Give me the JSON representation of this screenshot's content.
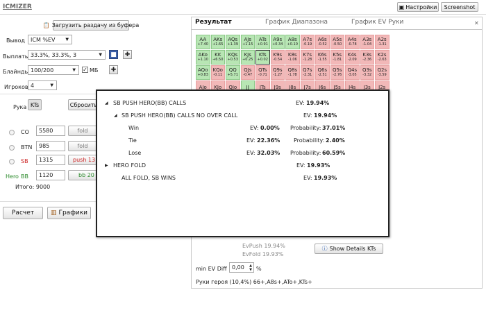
{
  "app": {
    "title": "ICMIZER"
  },
  "header": {
    "settings": "Настройки",
    "screenshot": "Screenshot"
  },
  "left": {
    "load_button": "Загрузить раздачу из буфера",
    "output_label": "Вывод",
    "output_value": "ICM %EV",
    "payouts_label": "Выплаты",
    "payouts_value": "33.3%, 33.3%, 3",
    "blinds_label": "Блайнды",
    "blinds_value": "100/200",
    "mb_label": "МБ",
    "players_label": "Игроков",
    "players_value": "4",
    "hand_label": "Рука",
    "hand_value": "KTs",
    "reset_button": "Сбросить",
    "players": [
      {
        "pos": "CO",
        "stack": "5580",
        "action": "fold"
      },
      {
        "pos": "BTN",
        "stack": "985",
        "action": "fold"
      },
      {
        "pos": "SB",
        "stack": "1315",
        "action": "push 13"
      },
      {
        "pos": "BB",
        "prefix": "Hero",
        "stack": "1120",
        "action": "bb 20"
      }
    ],
    "total": "Итого:  9000",
    "calc_button": "Расчет",
    "charts_button": "Графики"
  },
  "tabs": [
    "Результат",
    "График Диапазона",
    "График EV Руки"
  ],
  "grid": {
    "rows": [
      [
        [
          "AA",
          "+7.40"
        ],
        [
          "AKs",
          "+1.65"
        ],
        [
          "AQs",
          "+1.39"
        ],
        [
          "AJs",
          "+1.15"
        ],
        [
          "ATs",
          "+0.91"
        ],
        [
          "A9s",
          "+0.34"
        ],
        [
          "A8s",
          "+0.10"
        ],
        [
          "A7s",
          "-0.19"
        ],
        [
          "A6s",
          "-0.52"
        ],
        [
          "A5s",
          "-0.50"
        ],
        [
          "A4s",
          "-0.78"
        ],
        [
          "A3s",
          "-1.04"
        ],
        [
          "A2s",
          "-1.31"
        ]
      ],
      [
        [
          "AKo",
          "+1.10"
        ],
        [
          "KK",
          "+6.50"
        ],
        [
          "KQs",
          "+0.53"
        ],
        [
          "KJs",
          "+0.25"
        ],
        [
          "KTs",
          "+0.02"
        ],
        [
          "K9s",
          "-0.54"
        ],
        [
          "K8s",
          "-1.06"
        ],
        [
          "K7s",
          "-1.28"
        ],
        [
          "K6s",
          "-1.55"
        ],
        [
          "K5s",
          "-1.81"
        ],
        [
          "K4s",
          "-2.09"
        ],
        [
          "K3s",
          "-2.36"
        ],
        [
          "K2s",
          "-2.63"
        ]
      ],
      [
        [
          "AQo",
          "+0.83"
        ],
        [
          "KQo",
          "-0.11"
        ],
        [
          "QQ",
          "+5.71"
        ],
        [
          "QJs",
          "-0.47"
        ],
        [
          "QTs",
          "-0.71"
        ],
        [
          "Q9s",
          "-1.27"
        ],
        [
          "Q8s",
          "-1.78"
        ],
        [
          "Q7s",
          "-2.31"
        ],
        [
          "Q6s",
          "-2.51"
        ],
        [
          "Q5s",
          "-2.76"
        ],
        [
          "Q4s",
          "-3.05"
        ],
        [
          "Q3s",
          "-3.32"
        ],
        [
          "Q2s",
          "-3.59"
        ]
      ],
      [
        [
          "AJo",
          ""
        ],
        [
          "KJo",
          ""
        ],
        [
          "QJo",
          ""
        ],
        [
          "JJ",
          ""
        ],
        [
          "JTs",
          ""
        ],
        [
          "J9s",
          ""
        ],
        [
          "J8s",
          ""
        ],
        [
          "J7s",
          ""
        ],
        [
          "J6s",
          ""
        ],
        [
          "J5s",
          ""
        ],
        [
          "J4s",
          ""
        ],
        [
          "J3s",
          ""
        ],
        [
          "J2s",
          ""
        ]
      ]
    ]
  },
  "popup": {
    "sb_push": "SB PUSH HERO(BB) CALLS",
    "sb_push_ev": "19.94%",
    "no_over": "SB PUSH HERO(BB) CALLS NO OVER CALL",
    "no_over_ev": "19.94%",
    "win": "Win",
    "win_ev": "0.00%",
    "win_prob": "37.01%",
    "tie": "Tie",
    "tie_ev": "22.36%",
    "tie_prob": "2.40%",
    "lose": "Lose",
    "lose_ev": "32.03%",
    "lose_prob": "60.59%",
    "hero_fold": "HERO FOLD",
    "hero_fold_ev": "19.93%",
    "all_fold": "ALL FOLD, SB WINS",
    "all_fold_ev": "19.93%",
    "ev_label": "EV:",
    "prob_label": "Probability:"
  },
  "result": {
    "ev_push": "EvPush 19.94%",
    "ev_fold": "EvFold 19.93%",
    "show_details": "Show Details KTs",
    "min_ev_label": "min EV Diff",
    "min_ev_value": "0,00",
    "percent": "%",
    "hero_hands": "Руки героя  (10,4%) 66+,A8s+,ATo+,KTs+"
  },
  "colors": {
    "push": "#b8e6b4",
    "fold": "#f2b8b8",
    "red_text": "#cc2222",
    "green_text": "#2a8a2a"
  }
}
